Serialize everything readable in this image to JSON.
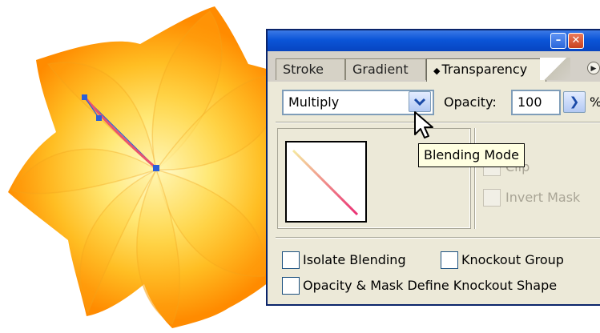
{
  "palette": {
    "window_buttons": {
      "minimize_icon": "minimize-icon",
      "close_icon": "close-icon"
    },
    "tabs": [
      {
        "label": "Stroke",
        "active": false
      },
      {
        "label": "Gradient",
        "active": false
      },
      {
        "label": "Transparency",
        "active": true,
        "icon": "up-down-arrows-icon"
      }
    ],
    "menu_icon": "palette-menu-icon",
    "blending_mode": {
      "value": "Multiply",
      "arrow_icon": "chevron-down-icon"
    },
    "opacity": {
      "label": "Opacity:",
      "value": "100",
      "unit": "%",
      "arrow_icon": "chevron-right-icon"
    },
    "tooltip": "Blending Mode",
    "mask_options": {
      "clip": {
        "label": "Clip",
        "checked": false,
        "enabled": false
      },
      "invert_mask": {
        "label": "Invert Mask",
        "checked": false,
        "enabled": false
      }
    },
    "group_options": {
      "isolate_blending": {
        "label": "Isolate Blending",
        "checked": false
      },
      "knockout_group": {
        "label": "Knockout Group",
        "checked": false
      },
      "opacity_mask_knockout": {
        "label": "Opacity & Mask Define Knockout Shape",
        "checked": false
      }
    }
  },
  "colors": {
    "title_bar": "#0b55d8",
    "panel_bg": "#ece9d8",
    "flower_outer": "#ff8a00",
    "flower_inner": "#fff6b0",
    "gradient_start": "#f5e9a0",
    "gradient_end": "#ea2f74",
    "path_selection": "#2b5fd9"
  }
}
